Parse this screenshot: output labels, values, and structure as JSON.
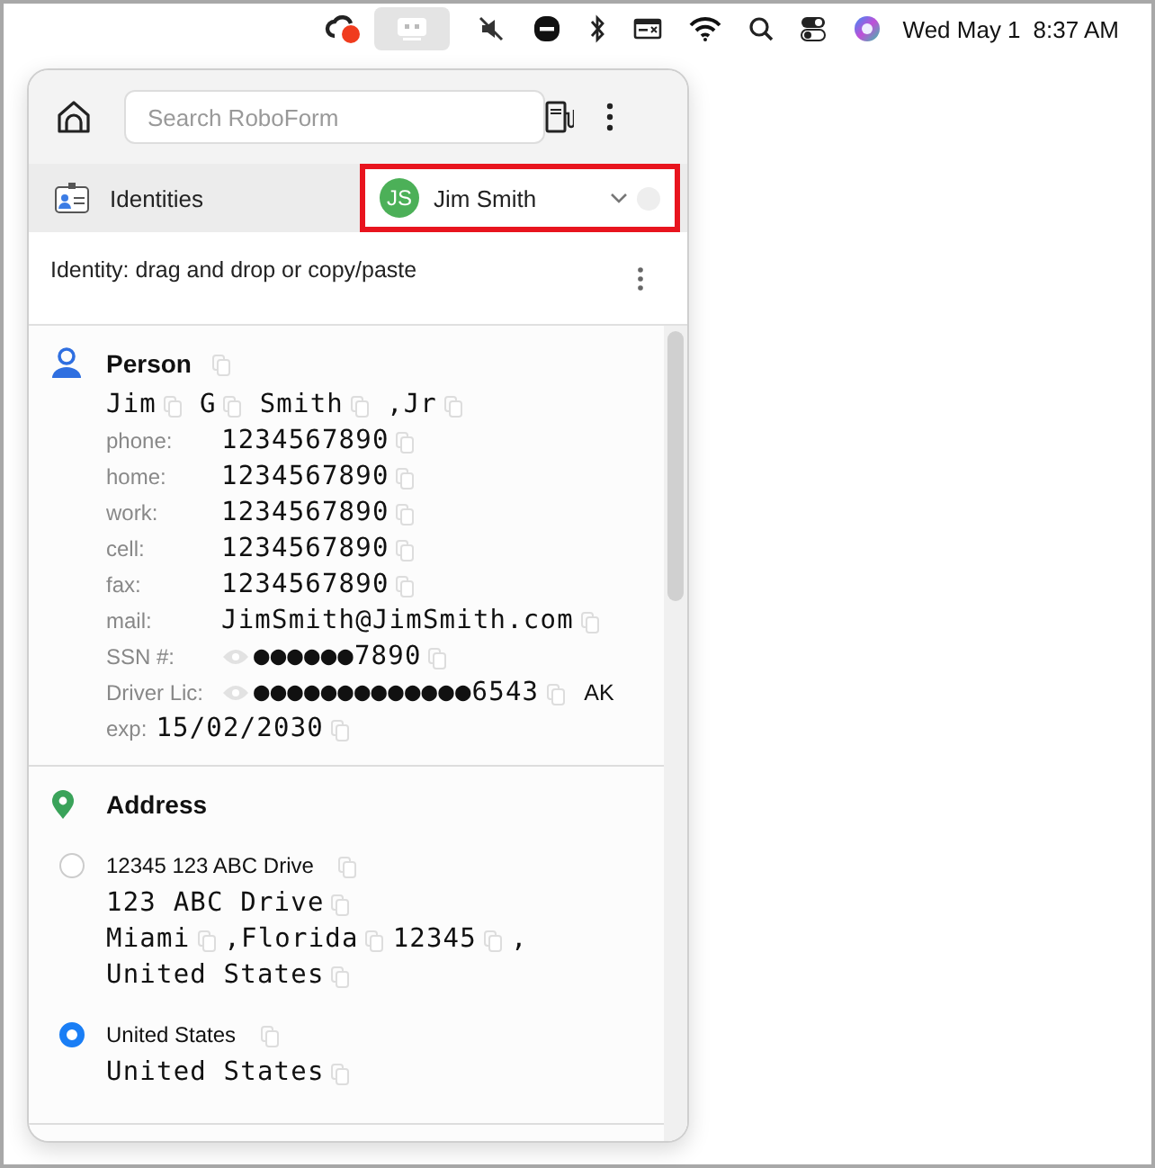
{
  "menu_bar": {
    "date": "Wed May 1",
    "time": "8:37 AM"
  },
  "popup": {
    "search": {
      "placeholder": "Search RoboForm"
    },
    "section": "Identities",
    "identity": {
      "initials": "JS",
      "name": "Jim Smith",
      "selected": true
    },
    "hint": "Identity: drag and drop or copy/paste",
    "person": {
      "title": "Person",
      "name_tokens": [
        {
          "kind": "value",
          "text": "Jim"
        },
        {
          "kind": "value",
          "text": "G"
        },
        {
          "kind": "value",
          "text": "Smith"
        },
        {
          "kind": "punct",
          "text": ","
        },
        {
          "kind": "value",
          "text": "Jr"
        }
      ],
      "fields": [
        {
          "kind": "plain",
          "label": "phone:",
          "value": "1234567890"
        },
        {
          "kind": "plain",
          "label": "home:",
          "value": "1234567890"
        },
        {
          "kind": "plain",
          "label": "work:",
          "value": "1234567890"
        },
        {
          "kind": "plain",
          "label": "cell:",
          "value": "1234567890"
        },
        {
          "kind": "plain",
          "label": "fax:",
          "value": "1234567890"
        },
        {
          "kind": "plain",
          "label": "mail:",
          "value": "JimSmith@JimSmith.com"
        },
        {
          "kind": "masked",
          "label": "SSN #:",
          "value": "●●●●●●7890"
        },
        {
          "kind": "masked",
          "label": "Driver Lic:",
          "value": "●●●●●●●●●●●●●6543",
          "extra": "AK"
        },
        {
          "kind": "inline",
          "label": "exp:",
          "value": "15/02/2030"
        }
      ]
    },
    "address": {
      "title": "Address",
      "entries": [
        {
          "selected": false,
          "title": "12345 123 ABC Drive",
          "lines": [
            [
              {
                "kind": "value",
                "text": "123 ABC Drive"
              }
            ],
            [
              {
                "kind": "value",
                "text": "Miami"
              },
              {
                "kind": "punct",
                "text": ","
              },
              {
                "kind": "value",
                "text": "Florida"
              },
              {
                "kind": "value",
                "text": "12345"
              },
              {
                "kind": "punct",
                "text": ","
              }
            ],
            [
              {
                "kind": "value",
                "text": "United States"
              }
            ]
          ]
        },
        {
          "selected": true,
          "title": "United States",
          "lines": [
            [
              {
                "kind": "value",
                "text": "United States"
              }
            ]
          ]
        }
      ]
    }
  }
}
